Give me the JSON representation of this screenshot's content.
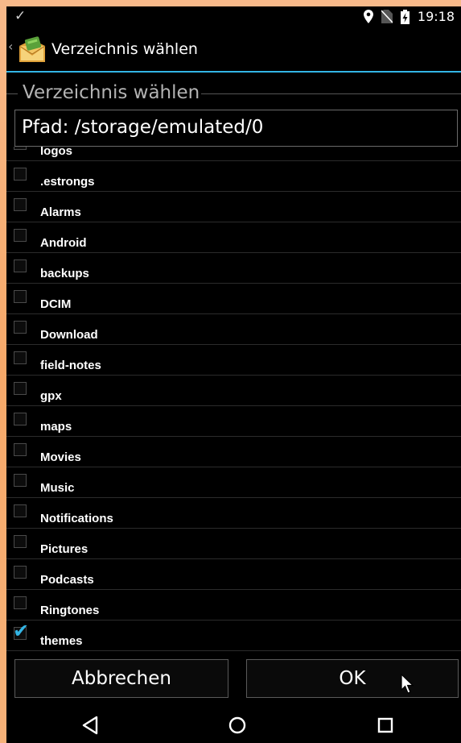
{
  "status_bar": {
    "time": "19:18"
  },
  "action_bar": {
    "title": "Verzeichnis wählen"
  },
  "dialog": {
    "title": "Verzeichnis wählen",
    "path": "Pfad: /storage/emulated/0",
    "items": [
      {
        "label": "logos",
        "checked": false
      },
      {
        "label": ".estrongs",
        "checked": false
      },
      {
        "label": "Alarms",
        "checked": false
      },
      {
        "label": "Android",
        "checked": false
      },
      {
        "label": "backups",
        "checked": false
      },
      {
        "label": "DCIM",
        "checked": false
      },
      {
        "label": "Download",
        "checked": false
      },
      {
        "label": "field-notes",
        "checked": false
      },
      {
        "label": "gpx",
        "checked": false
      },
      {
        "label": "maps",
        "checked": false
      },
      {
        "label": "Movies",
        "checked": false
      },
      {
        "label": "Music",
        "checked": false
      },
      {
        "label": "Notifications",
        "checked": false
      },
      {
        "label": "Pictures",
        "checked": false
      },
      {
        "label": "Podcasts",
        "checked": false
      },
      {
        "label": "Ringtones",
        "checked": false
      },
      {
        "label": "themes",
        "checked": true
      }
    ],
    "cancel_label": "Abbrechen",
    "ok_label": "OK"
  },
  "colors": {
    "accent": "#33b5e5",
    "background": "#000000"
  },
  "icons": [
    "check-icon",
    "location-pin-icon",
    "no-sim-icon",
    "battery-charging-icon",
    "back-chevron-icon",
    "app-logo-icon",
    "nav-back-icon",
    "nav-home-icon",
    "nav-recents-icon",
    "mouse-cursor-icon"
  ]
}
